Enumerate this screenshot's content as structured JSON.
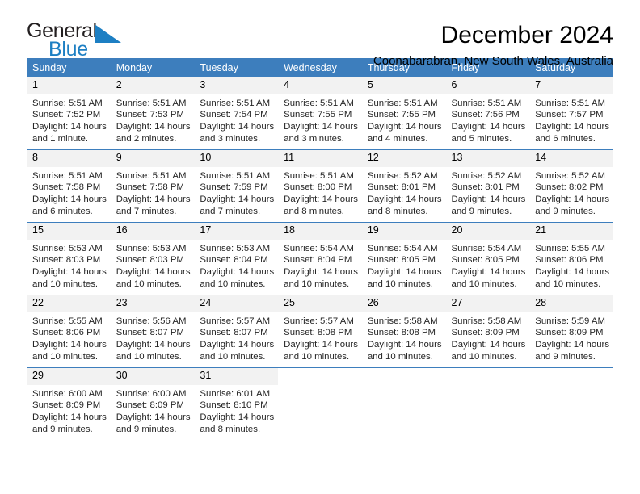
{
  "brand": {
    "name_top": "General",
    "name_bottom": "Blue",
    "triangle_color": "#1d7fc3"
  },
  "header": {
    "month_title": "December 2024",
    "location": "Coonabarabran, New South Wales, Australia"
  },
  "theme": {
    "header_blue": "#3d7ebd",
    "daynum_band": "#f2f2f2",
    "text": "#262626"
  },
  "calendar": {
    "weekday_headers": [
      "Sunday",
      "Monday",
      "Tuesday",
      "Wednesday",
      "Thursday",
      "Friday",
      "Saturday"
    ],
    "weeks": [
      [
        {
          "day": "1",
          "sunrise": "Sunrise: 5:51 AM",
          "sunset": "Sunset: 7:52 PM",
          "daylight_1": "Daylight: 14 hours",
          "daylight_2": "and 1 minute."
        },
        {
          "day": "2",
          "sunrise": "Sunrise: 5:51 AM",
          "sunset": "Sunset: 7:53 PM",
          "daylight_1": "Daylight: 14 hours",
          "daylight_2": "and 2 minutes."
        },
        {
          "day": "3",
          "sunrise": "Sunrise: 5:51 AM",
          "sunset": "Sunset: 7:54 PM",
          "daylight_1": "Daylight: 14 hours",
          "daylight_2": "and 3 minutes."
        },
        {
          "day": "4",
          "sunrise": "Sunrise: 5:51 AM",
          "sunset": "Sunset: 7:55 PM",
          "daylight_1": "Daylight: 14 hours",
          "daylight_2": "and 3 minutes."
        },
        {
          "day": "5",
          "sunrise": "Sunrise: 5:51 AM",
          "sunset": "Sunset: 7:55 PM",
          "daylight_1": "Daylight: 14 hours",
          "daylight_2": "and 4 minutes."
        },
        {
          "day": "6",
          "sunrise": "Sunrise: 5:51 AM",
          "sunset": "Sunset: 7:56 PM",
          "daylight_1": "Daylight: 14 hours",
          "daylight_2": "and 5 minutes."
        },
        {
          "day": "7",
          "sunrise": "Sunrise: 5:51 AM",
          "sunset": "Sunset: 7:57 PM",
          "daylight_1": "Daylight: 14 hours",
          "daylight_2": "and 6 minutes."
        }
      ],
      [
        {
          "day": "8",
          "sunrise": "Sunrise: 5:51 AM",
          "sunset": "Sunset: 7:58 PM",
          "daylight_1": "Daylight: 14 hours",
          "daylight_2": "and 6 minutes."
        },
        {
          "day": "9",
          "sunrise": "Sunrise: 5:51 AM",
          "sunset": "Sunset: 7:58 PM",
          "daylight_1": "Daylight: 14 hours",
          "daylight_2": "and 7 minutes."
        },
        {
          "day": "10",
          "sunrise": "Sunrise: 5:51 AM",
          "sunset": "Sunset: 7:59 PM",
          "daylight_1": "Daylight: 14 hours",
          "daylight_2": "and 7 minutes."
        },
        {
          "day": "11",
          "sunrise": "Sunrise: 5:51 AM",
          "sunset": "Sunset: 8:00 PM",
          "daylight_1": "Daylight: 14 hours",
          "daylight_2": "and 8 minutes."
        },
        {
          "day": "12",
          "sunrise": "Sunrise: 5:52 AM",
          "sunset": "Sunset: 8:01 PM",
          "daylight_1": "Daylight: 14 hours",
          "daylight_2": "and 8 minutes."
        },
        {
          "day": "13",
          "sunrise": "Sunrise: 5:52 AM",
          "sunset": "Sunset: 8:01 PM",
          "daylight_1": "Daylight: 14 hours",
          "daylight_2": "and 9 minutes."
        },
        {
          "day": "14",
          "sunrise": "Sunrise: 5:52 AM",
          "sunset": "Sunset: 8:02 PM",
          "daylight_1": "Daylight: 14 hours",
          "daylight_2": "and 9 minutes."
        }
      ],
      [
        {
          "day": "15",
          "sunrise": "Sunrise: 5:53 AM",
          "sunset": "Sunset: 8:03 PM",
          "daylight_1": "Daylight: 14 hours",
          "daylight_2": "and 10 minutes."
        },
        {
          "day": "16",
          "sunrise": "Sunrise: 5:53 AM",
          "sunset": "Sunset: 8:03 PM",
          "daylight_1": "Daylight: 14 hours",
          "daylight_2": "and 10 minutes."
        },
        {
          "day": "17",
          "sunrise": "Sunrise: 5:53 AM",
          "sunset": "Sunset: 8:04 PM",
          "daylight_1": "Daylight: 14 hours",
          "daylight_2": "and 10 minutes."
        },
        {
          "day": "18",
          "sunrise": "Sunrise: 5:54 AM",
          "sunset": "Sunset: 8:04 PM",
          "daylight_1": "Daylight: 14 hours",
          "daylight_2": "and 10 minutes."
        },
        {
          "day": "19",
          "sunrise": "Sunrise: 5:54 AM",
          "sunset": "Sunset: 8:05 PM",
          "daylight_1": "Daylight: 14 hours",
          "daylight_2": "and 10 minutes."
        },
        {
          "day": "20",
          "sunrise": "Sunrise: 5:54 AM",
          "sunset": "Sunset: 8:05 PM",
          "daylight_1": "Daylight: 14 hours",
          "daylight_2": "and 10 minutes."
        },
        {
          "day": "21",
          "sunrise": "Sunrise: 5:55 AM",
          "sunset": "Sunset: 8:06 PM",
          "daylight_1": "Daylight: 14 hours",
          "daylight_2": "and 10 minutes."
        }
      ],
      [
        {
          "day": "22",
          "sunrise": "Sunrise: 5:55 AM",
          "sunset": "Sunset: 8:06 PM",
          "daylight_1": "Daylight: 14 hours",
          "daylight_2": "and 10 minutes."
        },
        {
          "day": "23",
          "sunrise": "Sunrise: 5:56 AM",
          "sunset": "Sunset: 8:07 PM",
          "daylight_1": "Daylight: 14 hours",
          "daylight_2": "and 10 minutes."
        },
        {
          "day": "24",
          "sunrise": "Sunrise: 5:57 AM",
          "sunset": "Sunset: 8:07 PM",
          "daylight_1": "Daylight: 14 hours",
          "daylight_2": "and 10 minutes."
        },
        {
          "day": "25",
          "sunrise": "Sunrise: 5:57 AM",
          "sunset": "Sunset: 8:08 PM",
          "daylight_1": "Daylight: 14 hours",
          "daylight_2": "and 10 minutes."
        },
        {
          "day": "26",
          "sunrise": "Sunrise: 5:58 AM",
          "sunset": "Sunset: 8:08 PM",
          "daylight_1": "Daylight: 14 hours",
          "daylight_2": "and 10 minutes."
        },
        {
          "day": "27",
          "sunrise": "Sunrise: 5:58 AM",
          "sunset": "Sunset: 8:09 PM",
          "daylight_1": "Daylight: 14 hours",
          "daylight_2": "and 10 minutes."
        },
        {
          "day": "28",
          "sunrise": "Sunrise: 5:59 AM",
          "sunset": "Sunset: 8:09 PM",
          "daylight_1": "Daylight: 14 hours",
          "daylight_2": "and 9 minutes."
        }
      ],
      [
        {
          "day": "29",
          "sunrise": "Sunrise: 6:00 AM",
          "sunset": "Sunset: 8:09 PM",
          "daylight_1": "Daylight: 14 hours",
          "daylight_2": "and 9 minutes."
        },
        {
          "day": "30",
          "sunrise": "Sunrise: 6:00 AM",
          "sunset": "Sunset: 8:09 PM",
          "daylight_1": "Daylight: 14 hours",
          "daylight_2": "and 9 minutes."
        },
        {
          "day": "31",
          "sunrise": "Sunrise: 6:01 AM",
          "sunset": "Sunset: 8:10 PM",
          "daylight_1": "Daylight: 14 hours",
          "daylight_2": "and 8 minutes."
        },
        {
          "day": "",
          "sunrise": "",
          "sunset": "",
          "daylight_1": "",
          "daylight_2": ""
        },
        {
          "day": "",
          "sunrise": "",
          "sunset": "",
          "daylight_1": "",
          "daylight_2": ""
        },
        {
          "day": "",
          "sunrise": "",
          "sunset": "",
          "daylight_1": "",
          "daylight_2": ""
        },
        {
          "day": "",
          "sunrise": "",
          "sunset": "",
          "daylight_1": "",
          "daylight_2": ""
        }
      ]
    ]
  }
}
